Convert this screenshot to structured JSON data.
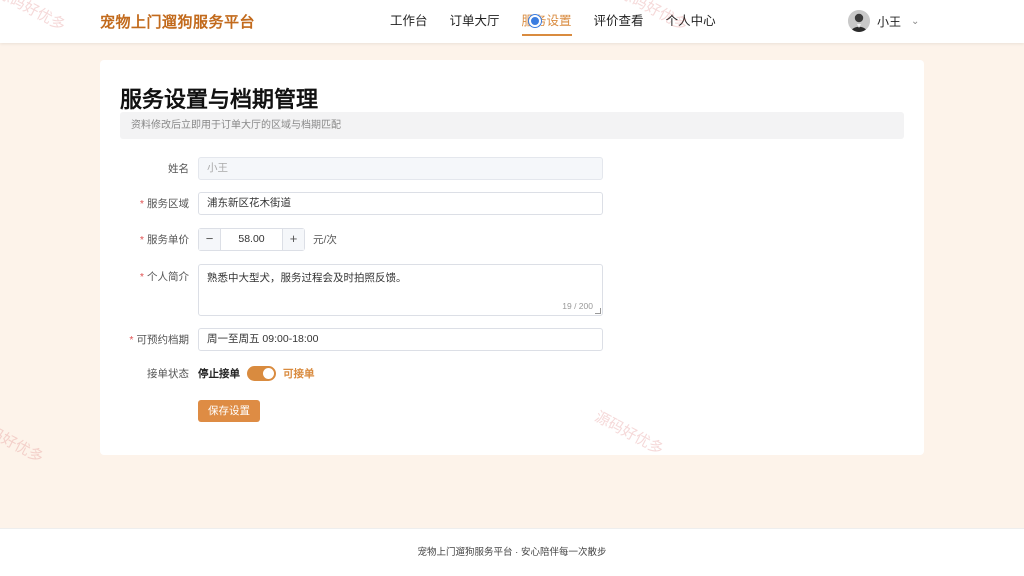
{
  "header": {
    "brand": "宠物上门遛狗服务平台",
    "nav": [
      "工作台",
      "订单大厅",
      "服务设置",
      "评价查看",
      "个人中心"
    ],
    "active_nav": "服务设置",
    "user_name": "小王"
  },
  "card": {
    "title": "服务设置与档期管理",
    "tip": "资料修改后立即用于订单大厅的区域与档期匹配"
  },
  "form": {
    "name": {
      "label": "姓名",
      "value": "小王"
    },
    "area": {
      "label": "服务区域",
      "value": "浦东新区花木街道"
    },
    "price": {
      "label": "服务单价",
      "value": "58.00",
      "unit": "元/次",
      "minus": "−",
      "plus": "+"
    },
    "intro": {
      "label": "个人简介",
      "value": "熟悉中大型犬，服务过程会及时拍照反馈。",
      "counter": "19 / 200"
    },
    "schedule": {
      "label": "可预约档期",
      "value": "周一至周五 09:00-18:00"
    },
    "status": {
      "label": "接单状态",
      "off_text": "停止接单",
      "on_text": "可接单"
    },
    "save_label": "保存设置"
  },
  "footer": {
    "text": "宠物上门遛狗服务平台 · 安心陪伴每一次散步"
  },
  "watermark": "源码好优多",
  "colors": {
    "accent": "#d98b3f",
    "brand": "#c26a1c",
    "required": "#e05252",
    "page_bg": "#fdf3ea"
  }
}
